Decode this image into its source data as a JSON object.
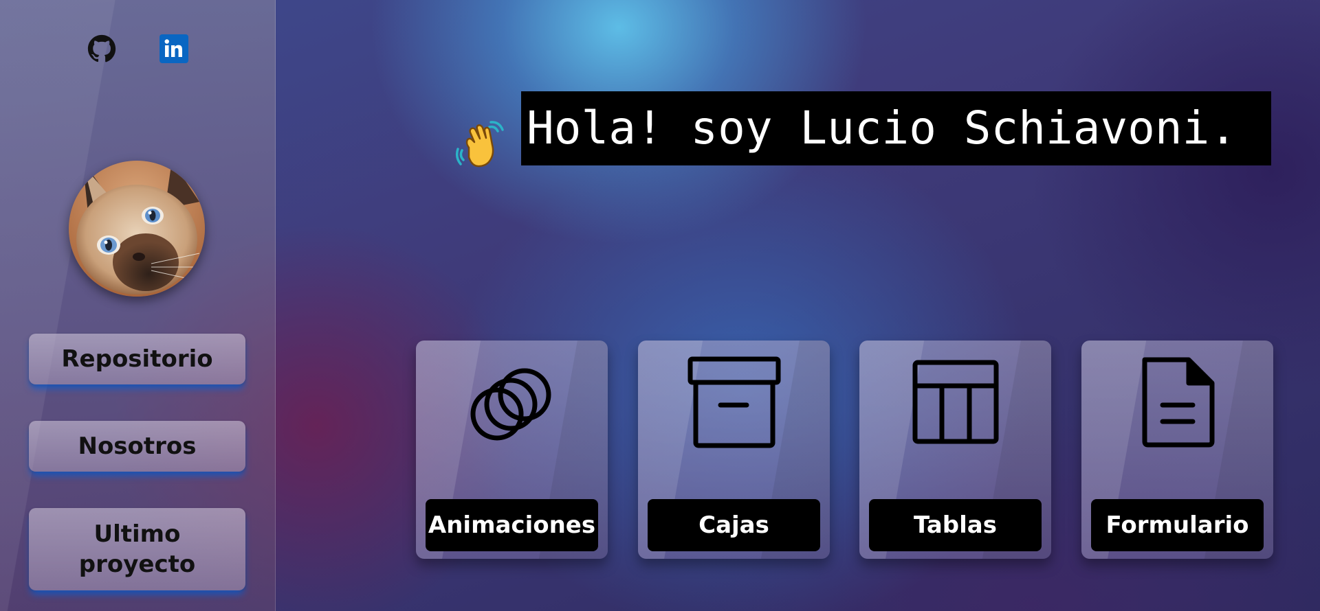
{
  "sidebar": {
    "social": [
      {
        "icon": "github-icon"
      },
      {
        "icon": "linkedin-icon"
      }
    ],
    "avatar": {
      "icon": "cat-avatar"
    },
    "nav": [
      {
        "label": "Repositorio"
      },
      {
        "label": "Nosotros"
      },
      {
        "label": "Ultimo proyecto"
      }
    ]
  },
  "hero": {
    "wave_icon": "waving-hand-icon",
    "greeting": "Hola! soy Lucio Schiavoni."
  },
  "cards": [
    {
      "label": "Animaciones",
      "icon": "circles-icon"
    },
    {
      "label": "Cajas",
      "icon": "archive-box-icon"
    },
    {
      "label": "Tablas",
      "icon": "table-icon"
    },
    {
      "label": "Formulario",
      "icon": "document-icon"
    }
  ],
  "colors": {
    "accent_glow": "#1f6fd6",
    "label_bg": "#000000",
    "label_text": "#ffffff",
    "linkedin_blue": "#0a66c2"
  }
}
